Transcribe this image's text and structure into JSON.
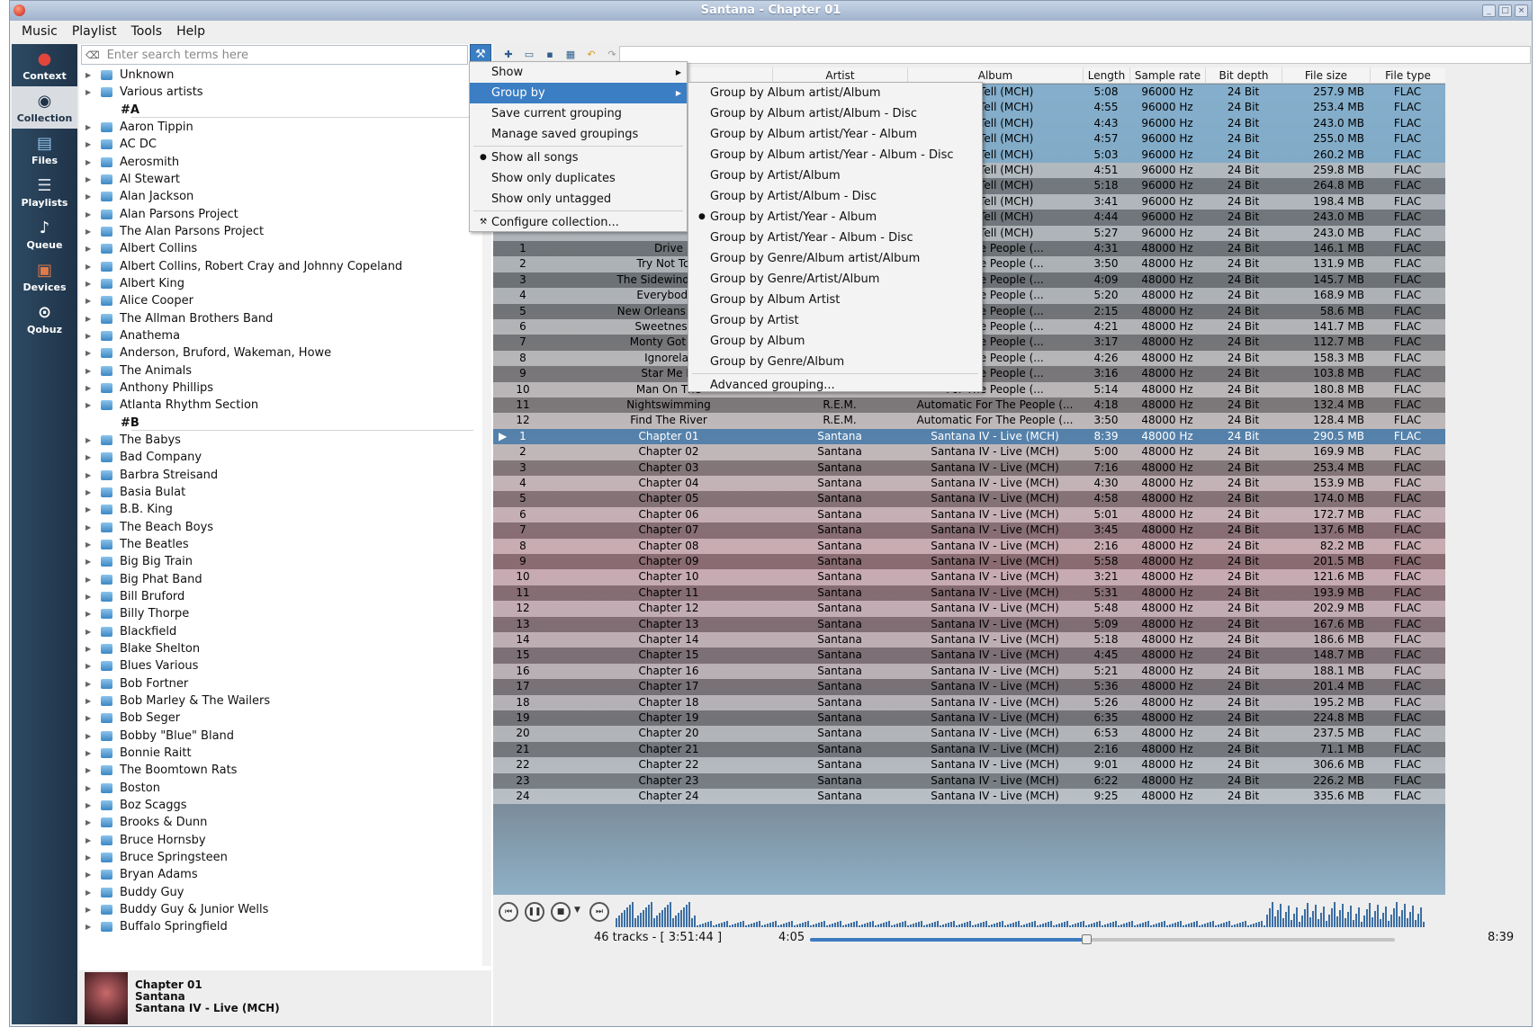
{
  "window": {
    "title": "Santana - Chapter 01"
  },
  "menubar": [
    "Music",
    "Playlist",
    "Tools",
    "Help"
  ],
  "sidebar": [
    {
      "label": "Context",
      "icon": "strawberry-icon"
    },
    {
      "label": "Collection",
      "icon": "disc-icon"
    },
    {
      "label": "Files",
      "icon": "files-icon"
    },
    {
      "label": "Playlists",
      "icon": "playlists-icon"
    },
    {
      "label": "Queue",
      "icon": "queue-icon"
    },
    {
      "label": "Devices",
      "icon": "devices-icon"
    },
    {
      "label": "Qobuz",
      "icon": "qobuz-icon"
    }
  ],
  "search": {
    "placeholder": "Enter search terms here"
  },
  "collection": [
    "Unknown",
    "Various artists",
    "#A",
    "Aaron Tippin",
    "AC DC",
    "Aerosmith",
    "Al Stewart",
    "Alan Jackson",
    "Alan Parsons Project",
    "The Alan Parsons Project",
    "Albert Collins",
    "Albert Collins, Robert Cray and Johnny Copeland",
    "Albert King",
    "Alice Cooper",
    "The Allman Brothers Band",
    "Anathema",
    "Anderson, Bruford, Wakeman, Howe",
    "The Animals",
    "Anthony Phillips",
    "Atlanta Rhythm Section",
    "#B",
    "The Babys",
    "Bad Company",
    "Barbra Streisand",
    "Basia Bulat",
    "B.B. King",
    "The Beach Boys",
    "The Beatles",
    "Big Big Train",
    "Big Phat Band",
    "Bill Bruford",
    "Billy Thorpe",
    "Blackfield",
    "Blake Shelton",
    "Blues Various",
    "Bob Fortner",
    "Bob Marley & The Wailers",
    "Bob Seger",
    "Bobby \"Blue\" Bland",
    "Bonnie Raitt",
    "The Boomtown Rats",
    "Boston",
    "Boz Scaggs",
    "Brooks & Dunn",
    "Bruce Hornsby",
    "Bruce Springsteen",
    "Bryan Adams",
    "Buddy Guy",
    "Buddy Guy & Junior Wells",
    "Buffalo Springfield"
  ],
  "now_playing": {
    "title": "Chapter 01",
    "artist": "Santana",
    "album": "Santana IV - Live (MCH)"
  },
  "columns": [
    "Artist",
    "Album",
    "Length",
    "Sample rate",
    "Bit depth",
    "File size",
    "File type"
  ],
  "tracks": [
    {
      "no": "",
      "title": "",
      "artist": "",
      "album": "Will Tell  (MCH)",
      "len": "5:08",
      "rate": "96000 Hz",
      "bits": "24 Bit",
      "size": "257.9 MB",
      "type": "FLAC",
      "s": "h"
    },
    {
      "no": "",
      "title": "",
      "artist": "",
      "album": "Will Tell  (MCH)",
      "len": "4:55",
      "rate": "96000 Hz",
      "bits": "24 Bit",
      "size": "253.4 MB",
      "type": "FLAC",
      "s": "h"
    },
    {
      "no": "",
      "title": "",
      "artist": "",
      "album": "Will Tell  (MCH)",
      "len": "4:43",
      "rate": "96000 Hz",
      "bits": "24 Bit",
      "size": "243.0 MB",
      "type": "FLAC",
      "s": "h"
    },
    {
      "no": "",
      "title": "",
      "artist": "",
      "album": "Will Tell  (MCH)",
      "len": "4:57",
      "rate": "96000 Hz",
      "bits": "24 Bit",
      "size": "255.0 MB",
      "type": "FLAC",
      "s": "h"
    },
    {
      "no": "",
      "title": "",
      "artist": "",
      "album": "Will Tell  (MCH)",
      "len": "5:03",
      "rate": "96000 Hz",
      "bits": "24 Bit",
      "size": "260.2 MB",
      "type": "FLAC",
      "s": "h"
    },
    {
      "no": "",
      "title": "",
      "artist": "",
      "album": "Will Tell  (MCH)",
      "len": "4:51",
      "rate": "96000 Hz",
      "bits": "24 Bit",
      "size": "259.8 MB",
      "type": "FLAC",
      "s": "a"
    },
    {
      "no": "",
      "title": "",
      "artist": "",
      "album": "Will Tell  (MCH)",
      "len": "5:18",
      "rate": "96000 Hz",
      "bits": "24 Bit",
      "size": "264.8 MB",
      "type": "FLAC",
      "s": "b"
    },
    {
      "no": "",
      "title": "",
      "artist": "",
      "album": "Will Tell  (MCH)",
      "len": "3:41",
      "rate": "96000 Hz",
      "bits": "24 Bit",
      "size": "198.4 MB",
      "type": "FLAC",
      "s": "a"
    },
    {
      "no": "",
      "title": "",
      "artist": "",
      "album": "Will Tell  (MCH)",
      "len": "4:44",
      "rate": "96000 Hz",
      "bits": "24 Bit",
      "size": "243.0 MB",
      "type": "FLAC",
      "s": "b"
    },
    {
      "no": "",
      "title": "",
      "artist": "",
      "album": "Will Tell  (MCH)",
      "len": "5:27",
      "rate": "96000 Hz",
      "bits": "24 Bit",
      "size": "243.0 MB",
      "type": "FLAC",
      "s": "a"
    },
    {
      "no": "1",
      "title": "Drive",
      "artist": "",
      "album": "For The People  (...",
      "len": "4:31",
      "rate": "48000 Hz",
      "bits": "24 Bit",
      "size": "146.1 MB",
      "type": "FLAC",
      "s": "b"
    },
    {
      "no": "2",
      "title": "Try Not To B",
      "artist": "",
      "album": "For The People  (...",
      "len": "3:50",
      "rate": "48000 Hz",
      "bits": "24 Bit",
      "size": "131.9 MB",
      "type": "FLAC",
      "s": "a"
    },
    {
      "no": "3",
      "title": "The Sidewinder Sle",
      "artist": "",
      "album": "For The People  (...",
      "len": "4:09",
      "rate": "48000 Hz",
      "bits": "24 Bit",
      "size": "145.7 MB",
      "type": "FLAC",
      "s": "b"
    },
    {
      "no": "4",
      "title": "Everybody I",
      "artist": "",
      "album": "For The People  (...",
      "len": "5:20",
      "rate": "48000 Hz",
      "bits": "24 Bit",
      "size": "168.9 MB",
      "type": "FLAC",
      "s": "a"
    },
    {
      "no": "5",
      "title": "New Orleans Instru",
      "artist": "",
      "album": "For The People  (...",
      "len": "2:15",
      "rate": "48000 Hz",
      "bits": "24 Bit",
      "size": "58.6 MB",
      "type": "FLAC",
      "s": "b"
    },
    {
      "no": "6",
      "title": "Sweetness F",
      "artist": "",
      "album": "For The People  (...",
      "len": "4:21",
      "rate": "48000 Hz",
      "bits": "24 Bit",
      "size": "141.7 MB",
      "type": "FLAC",
      "s": "a"
    },
    {
      "no": "7",
      "title": "Monty Got A R",
      "artist": "",
      "album": "For The People  (...",
      "len": "3:17",
      "rate": "48000 Hz",
      "bits": "24 Bit",
      "size": "112.7 MB",
      "type": "FLAC",
      "s": "b"
    },
    {
      "no": "8",
      "title": "Ignorelar",
      "artist": "",
      "album": "For The People  (...",
      "len": "4:26",
      "rate": "48000 Hz",
      "bits": "24 Bit",
      "size": "158.3 MB",
      "type": "FLAC",
      "s": "a"
    },
    {
      "no": "9",
      "title": "Star Me Ki",
      "artist": "",
      "album": "For The People  (...",
      "len": "3:16",
      "rate": "48000 Hz",
      "bits": "24 Bit",
      "size": "103.8 MB",
      "type": "FLAC",
      "s": "b"
    },
    {
      "no": "10",
      "title": "Man On The",
      "artist": "",
      "album": "For The People  (...",
      "len": "5:14",
      "rate": "48000 Hz",
      "bits": "24 Bit",
      "size": "180.8 MB",
      "type": "FLAC",
      "s": "a"
    },
    {
      "no": "11",
      "title": "Nightswimming",
      "artist": "R.E.M.",
      "album": "Automatic For The People  (...",
      "len": "4:18",
      "rate": "48000 Hz",
      "bits": "24 Bit",
      "size": "132.4 MB",
      "type": "FLAC",
      "s": "b"
    },
    {
      "no": "12",
      "title": "Find The River",
      "artist": "R.E.M.",
      "album": "Automatic For The People  (...",
      "len": "3:50",
      "rate": "48000 Hz",
      "bits": "24 Bit",
      "size": "128.4 MB",
      "type": "FLAC",
      "s": "a"
    },
    {
      "no": "1",
      "title": "Chapter 01",
      "artist": "Santana",
      "album": "Santana IV - Live  (MCH)",
      "len": "8:39",
      "rate": "48000 Hz",
      "bits": "24 Bit",
      "size": "290.5 MB",
      "type": "FLAC",
      "s": "sel"
    },
    {
      "no": "2",
      "title": "Chapter 02",
      "artist": "Santana",
      "album": "Santana IV - Live  (MCH)",
      "len": "5:00",
      "rate": "48000 Hz",
      "bits": "24 Bit",
      "size": "169.9 MB",
      "type": "FLAC",
      "s": "a"
    },
    {
      "no": "3",
      "title": "Chapter 03",
      "artist": "Santana",
      "album": "Santana IV - Live  (MCH)",
      "len": "7:16",
      "rate": "48000 Hz",
      "bits": "24 Bit",
      "size": "253.4 MB",
      "type": "FLAC",
      "s": "b"
    },
    {
      "no": "4",
      "title": "Chapter 04",
      "artist": "Santana",
      "album": "Santana IV - Live  (MCH)",
      "len": "4:30",
      "rate": "48000 Hz",
      "bits": "24 Bit",
      "size": "153.9 MB",
      "type": "FLAC",
      "s": "a"
    },
    {
      "no": "5",
      "title": "Chapter 05",
      "artist": "Santana",
      "album": "Santana IV - Live  (MCH)",
      "len": "4:58",
      "rate": "48000 Hz",
      "bits": "24 Bit",
      "size": "174.0 MB",
      "type": "FLAC",
      "s": "b"
    },
    {
      "no": "6",
      "title": "Chapter 06",
      "artist": "Santana",
      "album": "Santana IV - Live  (MCH)",
      "len": "5:01",
      "rate": "48000 Hz",
      "bits": "24 Bit",
      "size": "172.7 MB",
      "type": "FLAC",
      "s": "a"
    },
    {
      "no": "7",
      "title": "Chapter 07",
      "artist": "Santana",
      "album": "Santana IV - Live  (MCH)",
      "len": "3:45",
      "rate": "48000 Hz",
      "bits": "24 Bit",
      "size": "137.6 MB",
      "type": "FLAC",
      "s": "b"
    },
    {
      "no": "8",
      "title": "Chapter 08",
      "artist": "Santana",
      "album": "Santana IV - Live  (MCH)",
      "len": "2:16",
      "rate": "48000 Hz",
      "bits": "24 Bit",
      "size": "82.2 MB",
      "type": "FLAC",
      "s": "a"
    },
    {
      "no": "9",
      "title": "Chapter 09",
      "artist": "Santana",
      "album": "Santana IV - Live  (MCH)",
      "len": "5:58",
      "rate": "48000 Hz",
      "bits": "24 Bit",
      "size": "201.5 MB",
      "type": "FLAC",
      "s": "b"
    },
    {
      "no": "10",
      "title": "Chapter 10",
      "artist": "Santana",
      "album": "Santana IV - Live  (MCH)",
      "len": "3:21",
      "rate": "48000 Hz",
      "bits": "24 Bit",
      "size": "121.6 MB",
      "type": "FLAC",
      "s": "a"
    },
    {
      "no": "11",
      "title": "Chapter 11",
      "artist": "Santana",
      "album": "Santana IV - Live  (MCH)",
      "len": "5:31",
      "rate": "48000 Hz",
      "bits": "24 Bit",
      "size": "193.9 MB",
      "type": "FLAC",
      "s": "b"
    },
    {
      "no": "12",
      "title": "Chapter 12",
      "artist": "Santana",
      "album": "Santana IV - Live  (MCH)",
      "len": "5:48",
      "rate": "48000 Hz",
      "bits": "24 Bit",
      "size": "202.9 MB",
      "type": "FLAC",
      "s": "a"
    },
    {
      "no": "13",
      "title": "Chapter 13",
      "artist": "Santana",
      "album": "Santana IV - Live  (MCH)",
      "len": "5:09",
      "rate": "48000 Hz",
      "bits": "24 Bit",
      "size": "167.6 MB",
      "type": "FLAC",
      "s": "b"
    },
    {
      "no": "14",
      "title": "Chapter 14",
      "artist": "Santana",
      "album": "Santana IV - Live  (MCH)",
      "len": "5:18",
      "rate": "48000 Hz",
      "bits": "24 Bit",
      "size": "186.6 MB",
      "type": "FLAC",
      "s": "a"
    },
    {
      "no": "15",
      "title": "Chapter 15",
      "artist": "Santana",
      "album": "Santana IV - Live  (MCH)",
      "len": "4:45",
      "rate": "48000 Hz",
      "bits": "24 Bit",
      "size": "148.7 MB",
      "type": "FLAC",
      "s": "b"
    },
    {
      "no": "16",
      "title": "Chapter 16",
      "artist": "Santana",
      "album": "Santana IV - Live  (MCH)",
      "len": "5:21",
      "rate": "48000 Hz",
      "bits": "24 Bit",
      "size": "188.1 MB",
      "type": "FLAC",
      "s": "a"
    },
    {
      "no": "17",
      "title": "Chapter 17",
      "artist": "Santana",
      "album": "Santana IV - Live  (MCH)",
      "len": "5:36",
      "rate": "48000 Hz",
      "bits": "24 Bit",
      "size": "201.4 MB",
      "type": "FLAC",
      "s": "b"
    },
    {
      "no": "18",
      "title": "Chapter 18",
      "artist": "Santana",
      "album": "Santana IV - Live  (MCH)",
      "len": "5:26",
      "rate": "48000 Hz",
      "bits": "24 Bit",
      "size": "195.2 MB",
      "type": "FLAC",
      "s": "a"
    },
    {
      "no": "19",
      "title": "Chapter 19",
      "artist": "Santana",
      "album": "Santana IV - Live  (MCH)",
      "len": "6:35",
      "rate": "48000 Hz",
      "bits": "24 Bit",
      "size": "224.8 MB",
      "type": "FLAC",
      "s": "b"
    },
    {
      "no": "20",
      "title": "Chapter 20",
      "artist": "Santana",
      "album": "Santana IV - Live  (MCH)",
      "len": "6:53",
      "rate": "48000 Hz",
      "bits": "24 Bit",
      "size": "237.5 MB",
      "type": "FLAC",
      "s": "a"
    },
    {
      "no": "21",
      "title": "Chapter 21",
      "artist": "Santana",
      "album": "Santana IV - Live  (MCH)",
      "len": "2:16",
      "rate": "48000 Hz",
      "bits": "24 Bit",
      "size": "71.1 MB",
      "type": "FLAC",
      "s": "b"
    },
    {
      "no": "22",
      "title": "Chapter 22",
      "artist": "Santana",
      "album": "Santana IV - Live  (MCH)",
      "len": "9:01",
      "rate": "48000 Hz",
      "bits": "24 Bit",
      "size": "306.6 MB",
      "type": "FLAC",
      "s": "a"
    },
    {
      "no": "23",
      "title": "Chapter 23",
      "artist": "Santana",
      "album": "Santana IV - Live  (MCH)",
      "len": "6:22",
      "rate": "48000 Hz",
      "bits": "24 Bit",
      "size": "226.2 MB",
      "type": "FLAC",
      "s": "b"
    },
    {
      "no": "24",
      "title": "Chapter 24",
      "artist": "Santana",
      "album": "Santana IV - Live  (MCH)",
      "len": "9:25",
      "rate": "48000 Hz",
      "bits": "24 Bit",
      "size": "335.6 MB",
      "type": "FLAC",
      "s": "a"
    }
  ],
  "context_menu": [
    {
      "label": "Show",
      "submenu": true
    },
    {
      "label": "Group by",
      "submenu": true,
      "highlighted": true
    },
    {
      "label": "Save current grouping"
    },
    {
      "label": "Manage saved groupings"
    },
    {
      "sep": true
    },
    {
      "label": "Show all songs",
      "checked": true
    },
    {
      "label": "Show only duplicates"
    },
    {
      "label": "Show only untagged"
    },
    {
      "sep": true
    },
    {
      "label": "Configure collection...",
      "icon": "wrench-icon"
    }
  ],
  "group_menu": [
    {
      "label": "Group by Album artist/Album"
    },
    {
      "label": "Group by Album artist/Album - Disc"
    },
    {
      "label": "Group by Album artist/Year - Album"
    },
    {
      "label": "Group by Album artist/Year - Album - Disc"
    },
    {
      "label": "Group by Artist/Album"
    },
    {
      "label": "Group by Artist/Album - Disc"
    },
    {
      "label": "Group by Artist/Year - Album",
      "checked": true
    },
    {
      "label": "Group by Artist/Year - Album - Disc"
    },
    {
      "label": "Group by Genre/Album artist/Album"
    },
    {
      "label": "Group by Genre/Artist/Album"
    },
    {
      "label": "Group by Album Artist"
    },
    {
      "label": "Group by Artist"
    },
    {
      "label": "Group by Album"
    },
    {
      "label": "Group by Genre/Album"
    },
    {
      "sep": true
    },
    {
      "label": "Advanced grouping..."
    }
  ],
  "status": {
    "tracks": "46 tracks - [ 3:51:44 ]",
    "elapsed": "4:05",
    "total": "8:39",
    "progress": 0.472
  },
  "colors": {
    "accent": "#3b7ec3",
    "sidebar": "#1f3348",
    "viz": "#3c6fa3"
  }
}
